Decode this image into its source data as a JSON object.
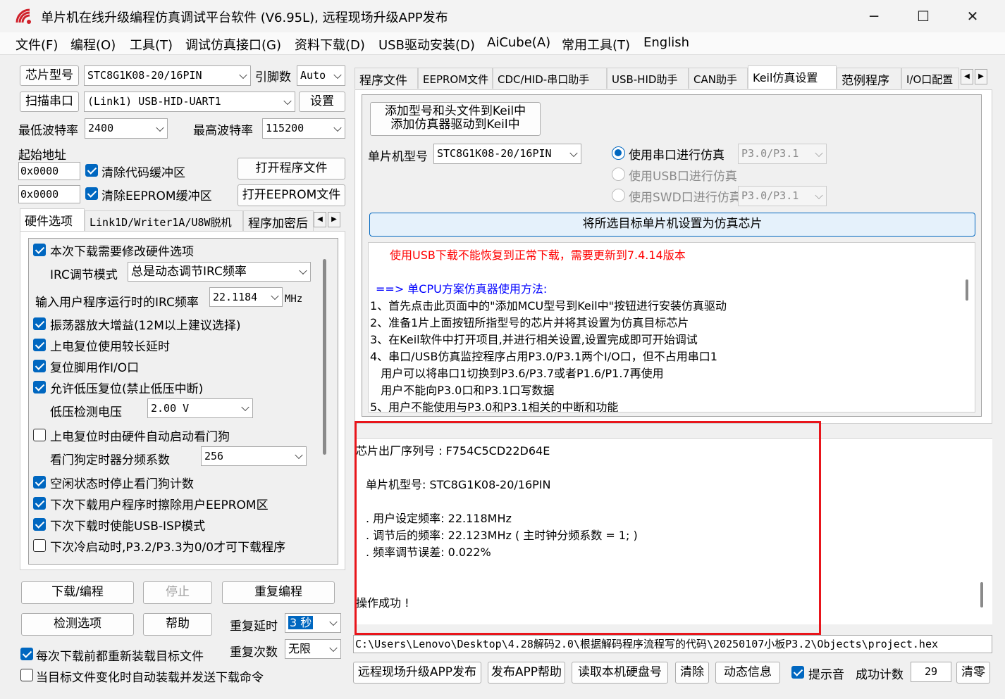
{
  "window": {
    "title": "单片机在线升级编程仿真调试平台软件 (V6.95L), 远程现场升级APP发布",
    "minimize": "─",
    "maximize": "☐",
    "close": "✕"
  },
  "menu": [
    "文件(F)",
    "编程(O)",
    "工具(T)",
    "调试仿真接口(G)",
    "资料下载(D)",
    "USB驱动安装(D)",
    "AiCube(A)",
    "常用工具(T)",
    "English"
  ],
  "left": {
    "chip_type_label": "芯片型号",
    "chip_type_value": "STC8G1K08-20/16PIN",
    "pin_label": "引脚数",
    "pin_value": "Auto",
    "scan_port_label": "扫描串口",
    "port_value": "(Link1) USB-HID-UART1",
    "settings_label": "设置",
    "min_baud_label": "最低波特率",
    "min_baud_value": "2400",
    "max_baud_label": "最高波特率",
    "max_baud_value": "115200",
    "start_addr_label": "起始地址",
    "addr1_value": "0x0000",
    "clear_code_label": "清除代码缓冲区",
    "open_program_label": "打开程序文件",
    "addr2_value": "0x0000",
    "clear_eeprom_label": "清除EEPROM缓冲区",
    "open_eeprom_label": "打开EEPROM文件",
    "tabs": [
      "硬件选项",
      "Link1D/Writer1A/U8W脱机",
      "程序加密后"
    ]
  },
  "hw": {
    "modify_hw": "本次下载需要修改硬件选项",
    "irc_mode_label": "IRC调节模式",
    "irc_mode_value": "总是动态调节IRC频率",
    "irc_freq_label": "输入用户程序运行时的IRC频率",
    "irc_freq_value": "22.1184",
    "irc_freq_unit": "MHz",
    "osc_gain": "振荡器放大增益(12M以上建议选择)",
    "long_delay": "上电复位使用较长延时",
    "reset_pin_io": "复位脚用作I/O口",
    "lvd_reset": "允许低压复位(禁止低压中断)",
    "lvd_voltage_label": "低压检测电压",
    "lvd_voltage_value": "2.00 V",
    "wdt_auto": "上电复位时由硬件自动启动看门狗",
    "wdt_div_label": "看门狗定时器分频系数",
    "wdt_div_value": "256",
    "idle_stop_wdt": "空闲状态时停止看门狗计数",
    "erase_eeprom": "下次下载用户程序时擦除用户EEPROM区",
    "usb_isp": "下次下载时使能USB-ISP模式",
    "cold_start": "下次冷启动时,P3.2/P3.3为0/0才可下载程序"
  },
  "bottom_left": {
    "download": "下载/编程",
    "stop": "停止",
    "reprogram": "重复编程",
    "check_options": "检测选项",
    "help": "帮助",
    "repeat_delay_label": "重复延时",
    "repeat_delay_value": "3 秒",
    "repeat_count_label": "重复次数",
    "repeat_count_value": "无限",
    "reload_before": "每次下载前都重新装载目标文件",
    "auto_reload": "当目标文件变化时自动装载并发送下载命令"
  },
  "right": {
    "tabs": [
      "程序文件",
      "EEPROM文件",
      "CDC/HID-串口助手",
      "USB-HID助手",
      "CAN助手",
      "Keil仿真设置",
      "范例程序",
      "I/O口配置"
    ],
    "add_keil_line1": "添加型号和头文件到Keil中",
    "add_keil_line2": "添加仿真器驱动到Keil中",
    "mcu_type_label": "单片机型号",
    "mcu_type_value": "STC8G1K08-20/16PIN",
    "use_uart": "使用串口进行仿真",
    "uart_pins": "P3.0/P3.1",
    "use_usb": "使用USB口进行仿真",
    "use_swd": "使用SWD口进行仿真",
    "swd_pins": "P3.0/P3.1",
    "set_target": "将所选目标单片机设置为仿真芯片",
    "info_warning": "使用USB下载不能恢复到正常下载，需要更新到7.4.14版本",
    "info_heading": "==> 单CPU方案仿真器使用方法:",
    "info_lines": [
      "1、首先点击此页面中的\"添加MCU型号到Keil中\"按钮进行安装仿真驱动",
      "2、准备1片上面按钮所指型号的芯片并将其设置为仿真目标芯片",
      "3、在Keil软件中打开项目,并进行相关设置,设置完成即可开始调试",
      "4、串口/USB仿真监控程序占用P3.0/P3.1两个I/O口，但不占用串口1",
      "   用户可以将串口1切换到P3.6/P3.7或者P1.6/P1.7再使用",
      "   用户不能向P3.0口和P3.1口写数据",
      "5、用户不能使用与P3.0和P3.1相关的中断和功能"
    ]
  },
  "log": {
    "serial": "芯片出厂序列号 : F754C5CD22D64E",
    "mcu": "单片机型号: STC8G1K08-20/16PIN",
    "user_freq": ". 用户设定频率: 22.118MHz",
    "adj_freq": ". 调节后的频率: 22.123MHz ( 主时钟分频系数 = 1; )",
    "freq_err": ". 频率调节误差: 0.022%",
    "success": "操作成功 !"
  },
  "path": "C:\\Users\\Lenovo\\Desktop\\4.28解码2.0\\根据解码程序流程写的代码\\20250107小板P3.2\\Objects\\project.hex",
  "footer": {
    "publish": "远程现场升级APP发布",
    "publish_help": "发布APP帮助",
    "read_disk": "读取本机硬盘号",
    "clear": "清除",
    "dynamic_info": "动态信息",
    "sound": "提示音",
    "success_count_label": "成功计数",
    "success_count_value": "29",
    "reset_count": "清零"
  },
  "colors": {
    "accent": "#0067c0",
    "warning_text": "#ff0000",
    "info_text": "#0000ff",
    "highlight_box": "#e8151b",
    "set_target_bg": "#e5f1fb"
  }
}
